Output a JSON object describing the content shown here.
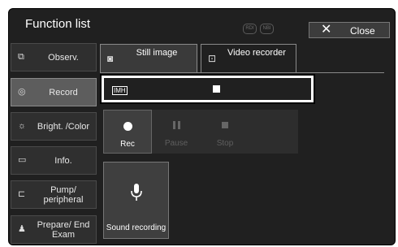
{
  "window": {
    "title": "Function list",
    "mode_badges": [
      "RDI",
      "NBI"
    ],
    "close_label": "Close"
  },
  "sidebar": {
    "items": [
      {
        "label": "Observ.",
        "icon": "observ-icon",
        "active": false
      },
      {
        "label": "Record",
        "icon": "record-icon",
        "active": true
      },
      {
        "label": "Bright. /Color",
        "icon": "brightness-icon",
        "active": false
      },
      {
        "label": "Info.",
        "icon": "info-icon",
        "active": false
      },
      {
        "label": "Pump/ peripheral",
        "icon": "pump-icon",
        "active": false
      },
      {
        "label": "Prepare/ End Exam",
        "icon": "prepare-icon",
        "active": false
      }
    ]
  },
  "tabs": [
    {
      "label": "Still image",
      "icon": "camera-icon",
      "active": false
    },
    {
      "label": "Video recorder",
      "icon": "video-recorder-icon",
      "active": true
    }
  ],
  "status_bar": {
    "device_label": "IMH",
    "state_icon": "stop-square-icon"
  },
  "controls": [
    {
      "label": "Rec",
      "icon": "record-dot-icon",
      "enabled": true
    },
    {
      "label": "Pause",
      "icon": "pause-icon",
      "enabled": false
    },
    {
      "label": "Stop",
      "icon": "stop-icon",
      "enabled": false
    }
  ],
  "sound_recording": {
    "label": "Sound recording",
    "icon": "microphone-icon"
  },
  "colors": {
    "background": "#202020",
    "active_item": "#5d5d5d",
    "disabled_text": "#5f5f5f"
  }
}
